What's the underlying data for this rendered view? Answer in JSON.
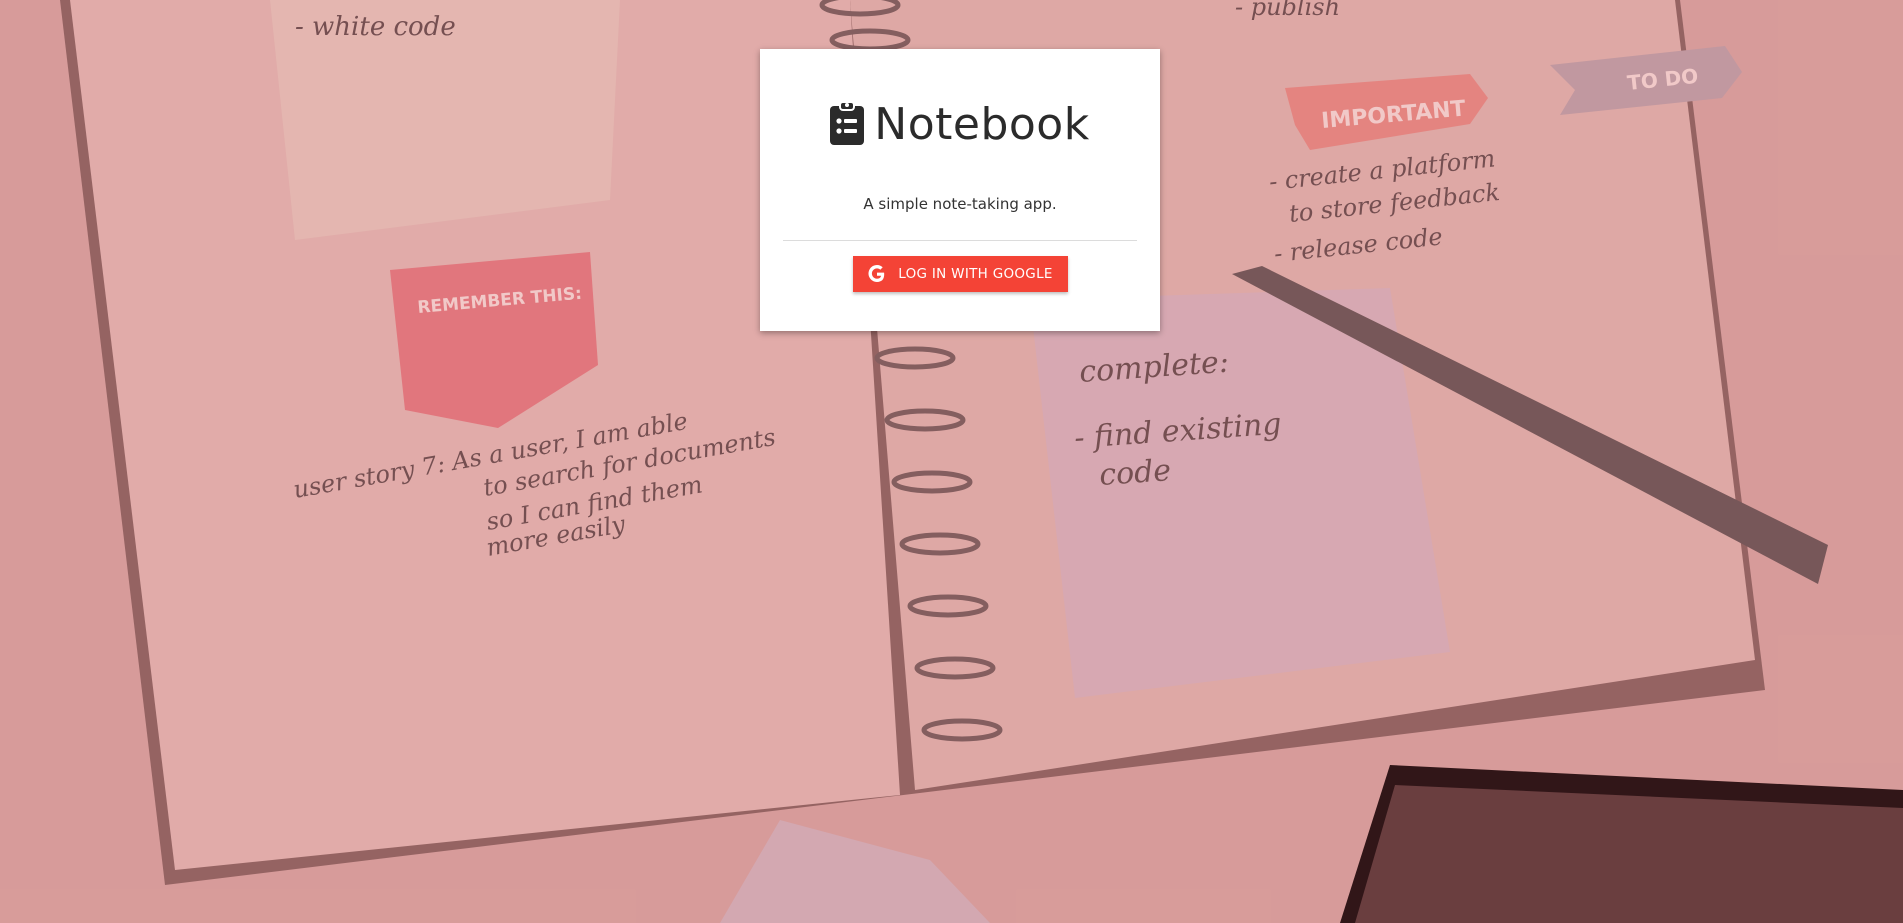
{
  "app": {
    "title": "Notebook",
    "tagline": "A simple note-taking app.",
    "accent_color": "#f44336",
    "icon": "clipboard-list-icon"
  },
  "login": {
    "google_button_label": "LOG IN WITH GOOGLE",
    "google_icon": "google-g-icon"
  },
  "background": {
    "notebook_left_lines": [
      "- white code"
    ],
    "sticker_label": "REMEMBER THIS:",
    "user_story": [
      "user story 7:  As a user, I am able",
      "to search for documents",
      "so I can  find  them",
      "more  easily"
    ],
    "important_tag": "IMPORTANT",
    "todo_tag": "TO DO",
    "right_page_lines": [
      "- publish",
      "- create  a platform",
      "to store  feedback",
      "- release  code"
    ],
    "sticky_note": [
      "complete:",
      "- find  existing",
      "code"
    ]
  }
}
